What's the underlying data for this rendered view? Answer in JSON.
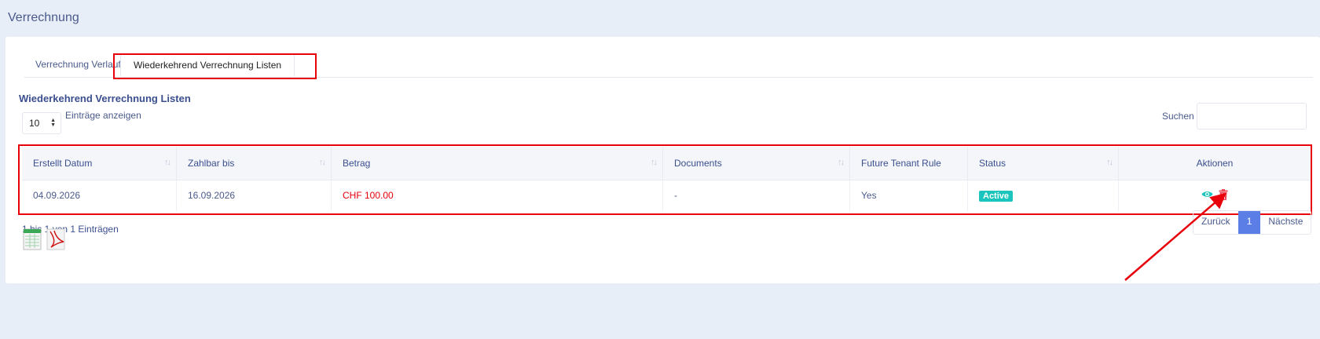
{
  "page": {
    "title": "Verrechnung"
  },
  "tabs": [
    {
      "label": "Verrechnung Verlauf"
    },
    {
      "label": "Wiederkehrend Verrechnung Listen"
    }
  ],
  "list": {
    "title": "Wiederkehrend Verrechnung Listen",
    "length_value": "10",
    "length_label": "Einträge anzeigen",
    "search_label": "Suchen",
    "search_value": ""
  },
  "table": {
    "headers": [
      "Erstellt Datum",
      "Zahlbar bis",
      "Betrag",
      "Documents",
      "Future Tenant Rule",
      "Status",
      "Aktionen"
    ],
    "rows": [
      {
        "created": "04.09.2026",
        "due": "16.09.2026",
        "amount": "CHF 100.00",
        "documents": "-",
        "future_rule": "Yes",
        "status": "Active"
      }
    ]
  },
  "info": "1 bis 1 von 1 Einträgen",
  "pagination": {
    "prev": "Zurück",
    "page": "1",
    "next": "Nächste"
  },
  "colors": {
    "accent": "#5b7de6",
    "status_active": "#1bc5bd",
    "amount": "#e8000b",
    "highlight": "#e8000b"
  },
  "icons": [
    "view-eye-icon",
    "delete-trash-icon",
    "excel-export-icon",
    "pdf-export-icon",
    "sort-icon",
    "select-arrows-icon"
  ]
}
